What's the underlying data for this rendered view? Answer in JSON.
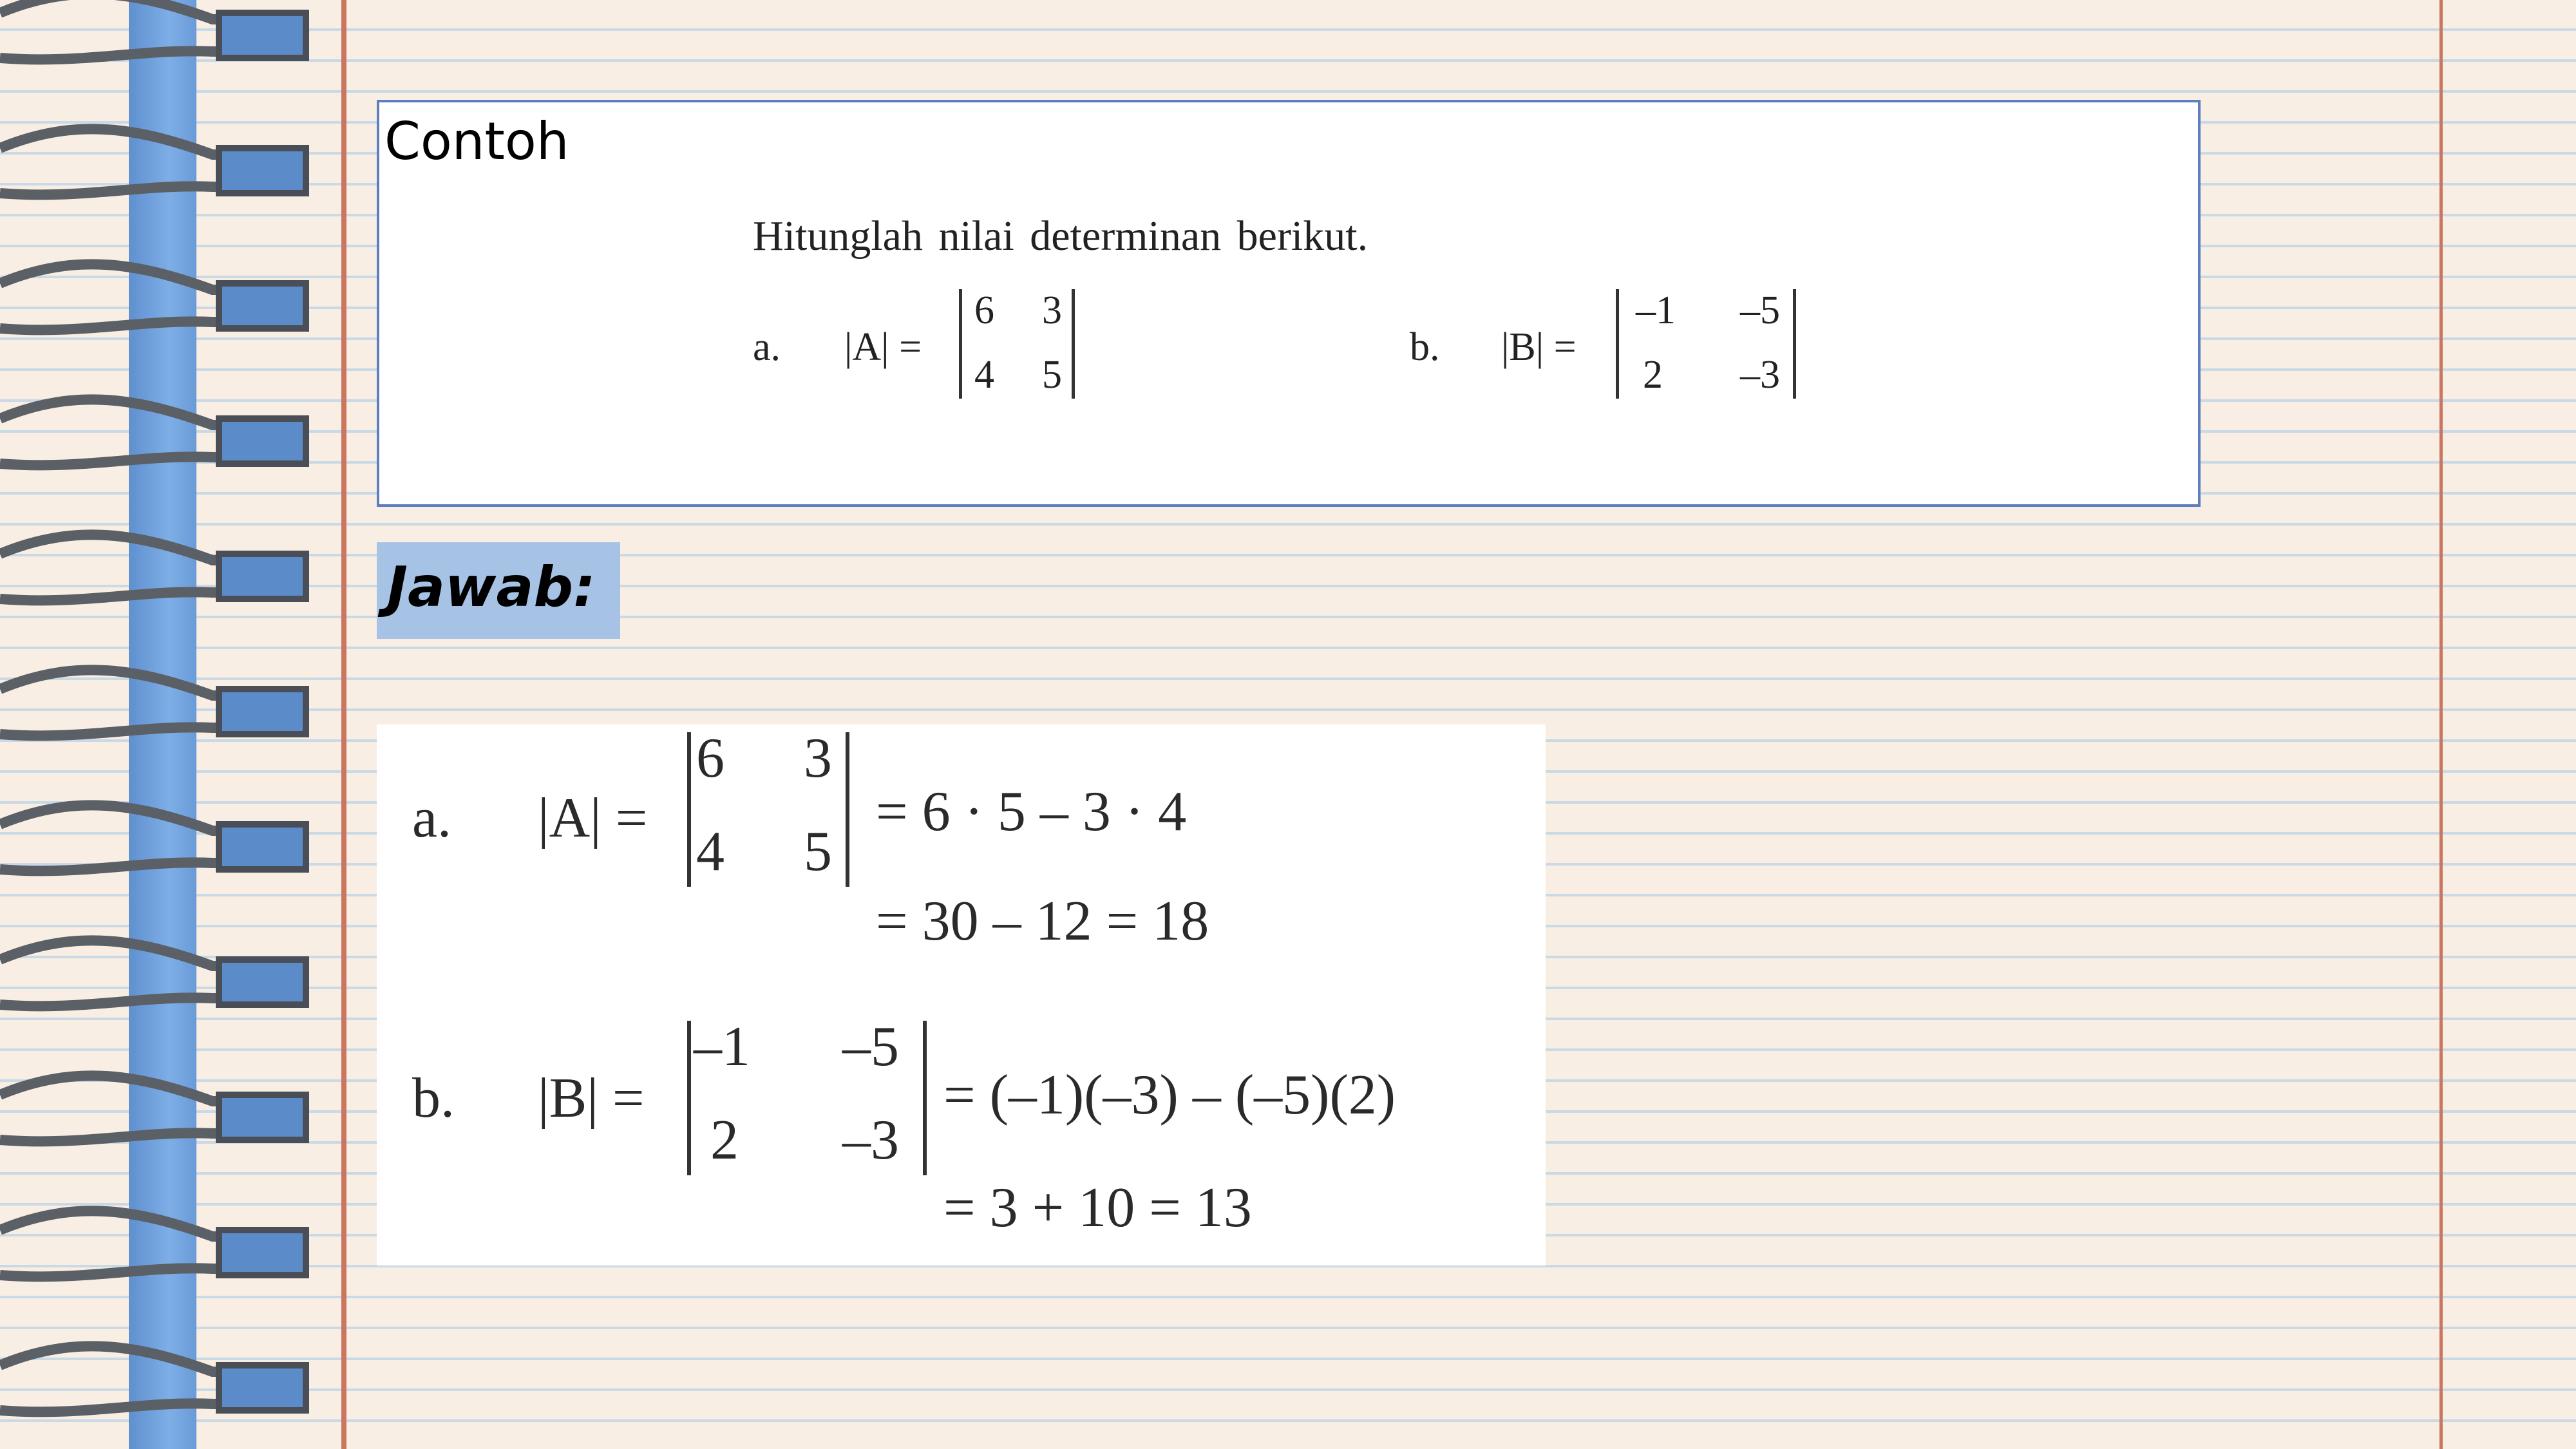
{
  "example": {
    "title": "Contoh",
    "question": "Hitunglah nilai determinan berikut.",
    "a": {
      "label": "a.",
      "lhs": "|A| =",
      "m11": "6",
      "m12": "3",
      "m21": "4",
      "m22": "5"
    },
    "b": {
      "label": "b.",
      "lhs": "|B| =",
      "m11": "–1",
      "m12": "–5",
      "m21": "2",
      "m22": "–3"
    }
  },
  "answer_label": "Jawab:",
  "answer": {
    "a": {
      "label": "a.",
      "lhs": "|A| =",
      "m11": "6",
      "m12": "3",
      "m21": "4",
      "m22": "5",
      "step1": "= 6 · 5 – 3 · 4",
      "step2": "= 30 – 12 = 18"
    },
    "b": {
      "label": "b.",
      "lhs": "|B| =",
      "m11": "–1",
      "m12": "–5",
      "m21": "2",
      "m22": "–3",
      "step1": "= (–1)(–3) – (–5)(2)",
      "step2": "= 3 + 10 = 13"
    }
  },
  "colors": {
    "binding": "#6a9bd8",
    "margin_line": "#c9775e",
    "jawab_bg": "#a6c3e6",
    "card_border": "#5d7fbf"
  }
}
